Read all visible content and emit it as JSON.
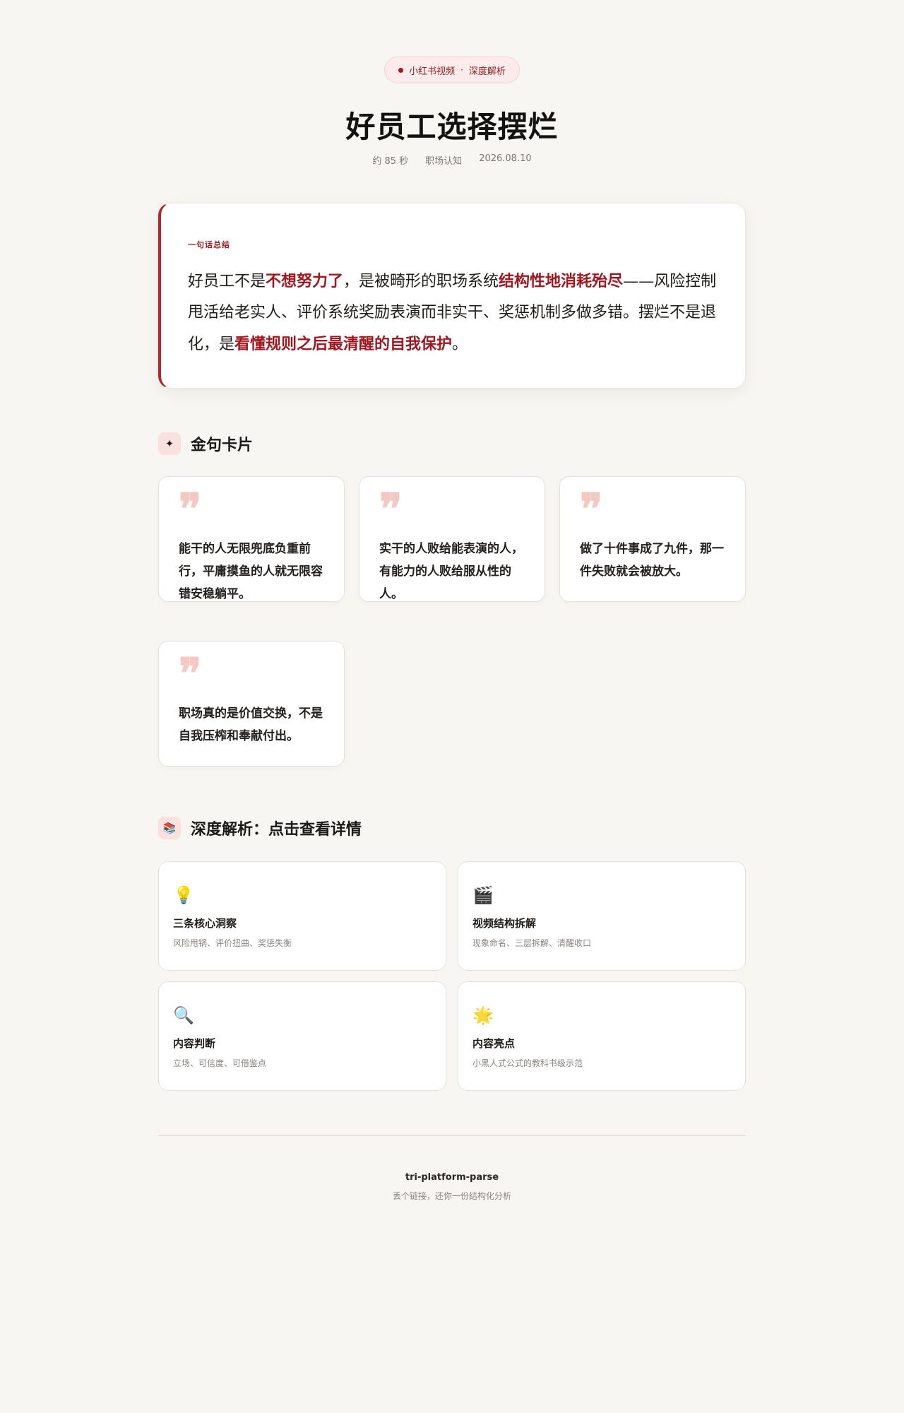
{
  "header": {
    "badge_platform": "小红书视频",
    "badge_separator": "·",
    "badge_type": "深度解析",
    "title": "好员工选择摆烂",
    "meta": [
      "约 85 秒",
      "职场认知",
      "2026.08.10"
    ]
  },
  "summary": {
    "label": "一句话总结",
    "parts": [
      {
        "text": "好员工不是",
        "hl": false
      },
      {
        "text": "不想努力了",
        "hl": true
      },
      {
        "text": "，是被畸形的职场系统",
        "hl": false
      },
      {
        "text": "结构性地消耗殆尽",
        "hl": true
      },
      {
        "text": "——风险控制甩活给老实人、评价系统奖励表演而非实干、奖惩机制多做多错。摆烂不是退化，是",
        "hl": false
      },
      {
        "text": "看懂规则之后最清醒的自我保护",
        "hl": true
      },
      {
        "text": "。",
        "hl": false
      }
    ]
  },
  "quotes_section": {
    "icon": "sparkle-icon",
    "icon_glyph": "✦",
    "title": "金句卡片",
    "quote_mark": "❞",
    "items": [
      "能干的人无限兜底负重前行，平庸摸鱼的人就无限容错安稳躺平。",
      "实干的人败给能表演的人，有能力的人败给服从性的人。",
      "做了十件事成了九件，那一件失败就会被放大。",
      "职场真的是价值交换，不是自我压榨和奉献付出。"
    ]
  },
  "analysis_section": {
    "icon": "books-icon",
    "icon_glyph": "📚",
    "title": "深度解析：点击查看详情",
    "cards": [
      {
        "icon": "lightbulb-icon",
        "glyph": "💡",
        "title": "三条核心洞察",
        "sub": "风险甩锅、评价扭曲、奖惩失衡"
      },
      {
        "icon": "clapper-icon",
        "glyph": "🎬",
        "title": "视频结构拆解",
        "sub": "现象命名、三层拆解、清醒收口"
      },
      {
        "icon": "magnifier-icon",
        "glyph": "🔍",
        "title": "内容判断",
        "sub": "立场、可信度、可借鉴点"
      },
      {
        "icon": "star-icon",
        "glyph": "🌟",
        "title": "内容亮点",
        "sub": "小黑人式公式的教科书级示范"
      }
    ]
  },
  "footer": {
    "name": "tri-platform-parse",
    "tagline": "丢个链接，还你一份结构化分析"
  },
  "colors": {
    "accent": "#a1171f",
    "background": "#f8f6f3",
    "badge_bg": "#fbeceb"
  }
}
